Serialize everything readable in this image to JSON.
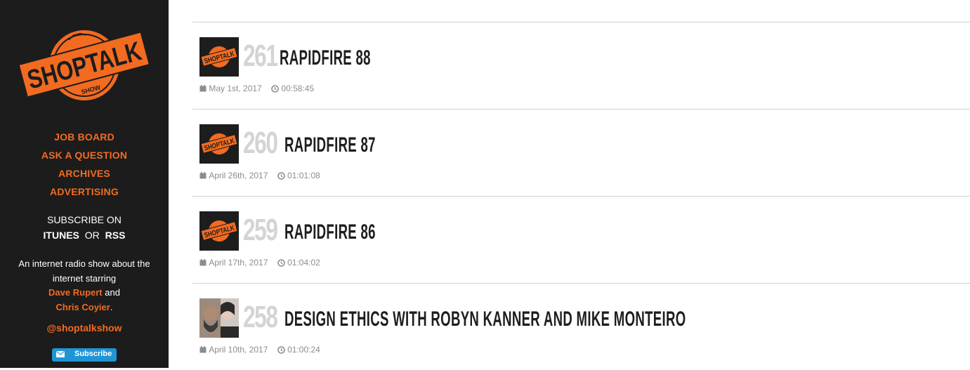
{
  "brand": {
    "logo_top": "SHOP",
    "logo_main": "TALK",
    "logo_sub": "SHOW",
    "accent": "#f26b21",
    "sidebar_bg": "#1c1c1c"
  },
  "nav": {
    "items": [
      {
        "label": "JOB BOARD"
      },
      {
        "label": "ASK A QUESTION"
      },
      {
        "label": "ARCHIVES"
      },
      {
        "label": "ADVERTISING"
      }
    ]
  },
  "subscribe": {
    "heading": "SUBSCRIBE ON",
    "itunes": "ITUNES",
    "or": "OR",
    "rss": "RSS"
  },
  "about": {
    "text1": "An internet radio show about the internet starring",
    "host1": "Dave Rupert",
    "and": "and",
    "host2": "Chris Coyier",
    "period": "."
  },
  "twitter": "@shoptalkshow",
  "subscribe_button": {
    "label": "Subscribe",
    "icon": "envelope-icon"
  },
  "episodes": [
    {
      "number": "261",
      "title": "RAPIDFIRE 88",
      "date": "May 1st, 2017",
      "duration": "00:58:45",
      "thumb": "logo"
    },
    {
      "number": "260",
      "title": "RAPIDFIRE 87",
      "date": "April 26th, 2017",
      "duration": "01:01:08",
      "thumb": "logo"
    },
    {
      "number": "259",
      "title": "RAPIDFIRE 86",
      "date": "April 17th, 2017",
      "duration": "01:04:02",
      "thumb": "logo"
    },
    {
      "number": "258",
      "title": "DESIGN ETHICS WITH ROBYN KANNER AND MIKE MONTEIRO",
      "date": "April 10th, 2017",
      "duration": "01:00:24",
      "thumb": "photo"
    }
  ]
}
